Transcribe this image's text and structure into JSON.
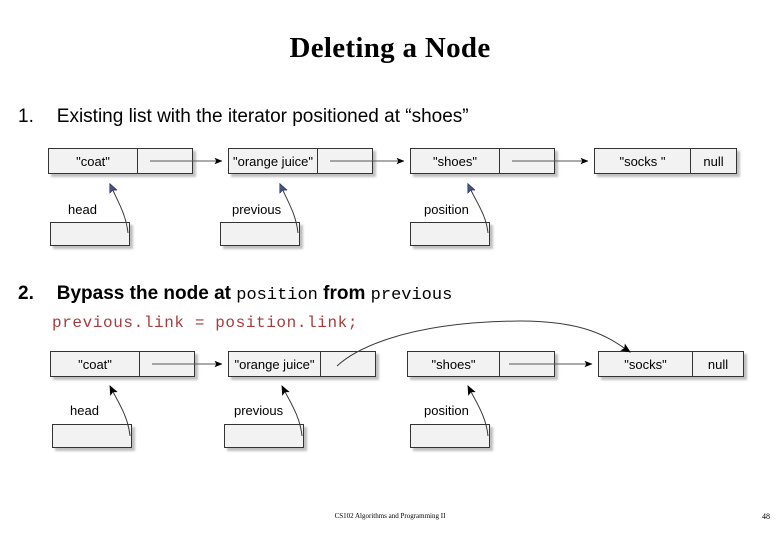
{
  "slide": {
    "title": "Deleting a Node",
    "footer": "CS102 Algorithms and Programming II",
    "page_number": "48"
  },
  "colors": {
    "code_red": "#A83C3C",
    "node_fill": "#F2F2F2",
    "node_border": "#333333",
    "shadow": "#8C8C8C",
    "arrow_blue": "#45538C",
    "arrow_black": "#000000",
    "link_line": "#555555"
  },
  "steps": [
    {
      "number": "1.",
      "text": "Existing list with the iterator positioned at “shoes”"
    },
    {
      "number": "2.",
      "text_parts": [
        {
          "kind": "plain",
          "text": "Bypass the node at "
        },
        {
          "kind": "mono",
          "text": "position"
        },
        {
          "kind": "plain",
          "text": " from "
        },
        {
          "kind": "mono",
          "text": "previous"
        }
      ]
    }
  ],
  "code": {
    "text": "previous.link = position.link;"
  },
  "diagram1": {
    "nodes": [
      {
        "data": "\"coat\"",
        "link": "",
        "link_kind": "pointer"
      },
      {
        "data": "\"orange juice\"",
        "link": "",
        "link_kind": "pointer"
      },
      {
        "data": "\"shoes\"",
        "link": "",
        "link_kind": "pointer"
      },
      {
        "data": "\"socks \"",
        "link": "null",
        "link_kind": "null"
      }
    ],
    "variables": [
      {
        "label": "head",
        "target": "\"coat\""
      },
      {
        "label": "previous",
        "target": "\"orange juice\""
      },
      {
        "label": "position",
        "target": "\"shoes\""
      }
    ]
  },
  "diagram2": {
    "nodes": [
      {
        "data": "\"coat\"",
        "link": "",
        "link_kind": "pointer"
      },
      {
        "data": "\"orange juice\"",
        "link": "",
        "link_kind": "bypass"
      },
      {
        "data": "\"shoes\"",
        "link": "",
        "link_kind": "pointer"
      },
      {
        "data": "\"socks\"",
        "link": "null",
        "link_kind": "null"
      }
    ],
    "variables": [
      {
        "label": "head",
        "target": "\"coat\""
      },
      {
        "label": "previous",
        "target": "\"orange juice\""
      },
      {
        "label": "position",
        "target": "\"shoes\""
      }
    ]
  }
}
